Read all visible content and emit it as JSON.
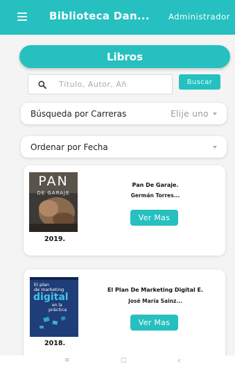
{
  "app": {
    "title": "Biblioteca Dan...",
    "user": "Administrador"
  },
  "section_title": "Libros",
  "search": {
    "placeholder": "Título, Autor, Añ",
    "button_label": "Buscar"
  },
  "filters": {
    "career_label": "Búsqueda por Carreras",
    "career_value": "Elije uno",
    "sort_label": "Ordenar por Fecha"
  },
  "books": [
    {
      "title": "Pan De Garaje.",
      "author": "Germán Torres...",
      "year": "2019.",
      "button": "Ver Mas",
      "cover_text": "PAN",
      "cover_subtext": "DE GARAJE"
    },
    {
      "title": "El Plan De Marketing Digital E.",
      "author": "José María Sainz...",
      "year": "2018.",
      "button": "Ver Mas",
      "cover_line1": "El plan",
      "cover_line2": "de marketing",
      "cover_line3": "digital",
      "cover_line4": "en la",
      "cover_line5": "práctica"
    }
  ],
  "nav": {
    "menu_glyph": "≡",
    "home_glyph": "□",
    "back_glyph": "‹"
  },
  "colors": {
    "accent": "#26c0c0",
    "background": "#f4f4f4"
  }
}
